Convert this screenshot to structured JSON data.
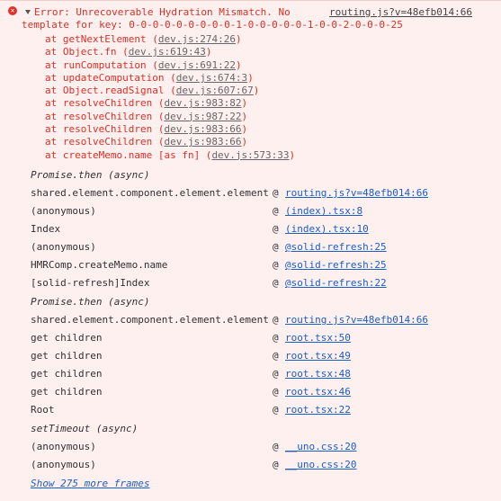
{
  "error": {
    "icon": "error-icon",
    "message_line1": "Error: Unrecoverable Hydration Mismatch. No",
    "message_line2": "template for key: 0-0-0-0-0-0-0-0-0-1-0-0-0-0-0-1-0-0-2-0-0-0-25",
    "header_link": "routing.js?v=48efb014:66",
    "colors": {
      "error_text": "#d93025",
      "link": "#1a5ec7",
      "background": "#fff0f0"
    }
  },
  "stack": [
    {
      "prefix": "at getNextElement (",
      "link": "dev.js:274:26",
      "suffix": ")"
    },
    {
      "prefix": "at Object.fn (",
      "link": "dev.js:619:43",
      "suffix": ")"
    },
    {
      "prefix": "at runComputation (",
      "link": "dev.js:691:22",
      "suffix": ")"
    },
    {
      "prefix": "at updateComputation (",
      "link": "dev.js:674:3",
      "suffix": ")"
    },
    {
      "prefix": "at Object.readSignal (",
      "link": "dev.js:607:67",
      "suffix": ")"
    },
    {
      "prefix": "at resolveChildren (",
      "link": "dev.js:983:82",
      "suffix": ")"
    },
    {
      "prefix": "at resolveChildren (",
      "link": "dev.js:987:22",
      "suffix": ")"
    },
    {
      "prefix": "at resolveChildren (",
      "link": "dev.js:983:66",
      "suffix": ")"
    },
    {
      "prefix": "at resolveChildren (",
      "link": "dev.js:983:66",
      "suffix": ")"
    },
    {
      "prefix": "at createMemo.name [as fn] (",
      "link": "dev.js:573:33",
      "suffix": ")"
    }
  ],
  "frames": [
    {
      "kind": "async",
      "text": "Promise.then (async)"
    },
    {
      "kind": "frame",
      "fn": "shared.element.component.element.element",
      "at": "@",
      "loc": "routing.js?v=48efb014:66"
    },
    {
      "kind": "frame",
      "fn": "(anonymous)",
      "at": "@",
      "loc": "(index).tsx:8"
    },
    {
      "kind": "frame",
      "fn": "Index",
      "at": "@",
      "loc": "(index).tsx:10"
    },
    {
      "kind": "frame",
      "fn": "(anonymous)",
      "at": "@",
      "loc": "@solid-refresh:25"
    },
    {
      "kind": "frame",
      "fn": "HMRComp.createMemo.name",
      "at": "@",
      "loc": "@solid-refresh:25"
    },
    {
      "kind": "frame",
      "fn": "[solid-refresh]Index",
      "at": "@",
      "loc": "@solid-refresh:22"
    },
    {
      "kind": "async",
      "text": "Promise.then (async)"
    },
    {
      "kind": "frame",
      "fn": "shared.element.component.element.element",
      "at": "@",
      "loc": "routing.js?v=48efb014:66"
    },
    {
      "kind": "frame",
      "fn": "get children",
      "at": "@",
      "loc": "root.tsx:50"
    },
    {
      "kind": "frame",
      "fn": "get children",
      "at": "@",
      "loc": "root.tsx:49"
    },
    {
      "kind": "frame",
      "fn": "get children",
      "at": "@",
      "loc": "root.tsx:48"
    },
    {
      "kind": "frame",
      "fn": "get children",
      "at": "@",
      "loc": "root.tsx:46"
    },
    {
      "kind": "frame",
      "fn": "Root",
      "at": "@",
      "loc": "root.tsx:22"
    },
    {
      "kind": "async",
      "text": "setTimeout (async)"
    },
    {
      "kind": "frame",
      "fn": "(anonymous)",
      "at": "@",
      "loc": "__uno.css:20"
    },
    {
      "kind": "frame",
      "fn": "(anonymous)",
      "at": "@",
      "loc": "__uno.css:20"
    }
  ],
  "show_more": "Show 275 more frames"
}
